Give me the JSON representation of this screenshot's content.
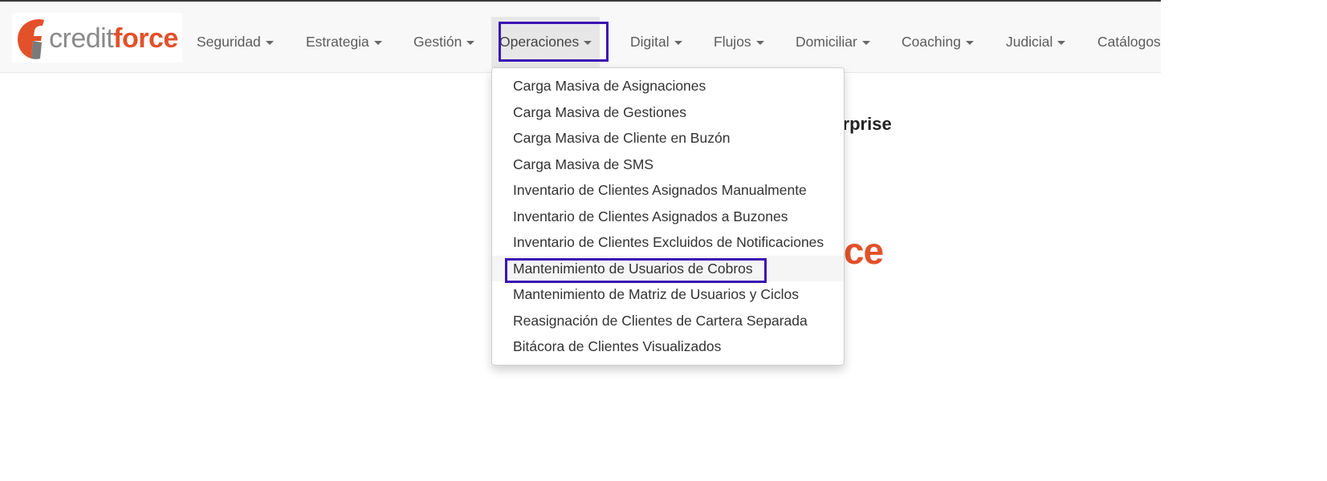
{
  "brand": {
    "credit": "credit",
    "force": "force",
    "logo_icon": "creditforce-f-icon",
    "accent_color": "#e2512a",
    "text_color": "#8a8a8a"
  },
  "nav": {
    "items": [
      {
        "label": "Seguridad"
      },
      {
        "label": "Estrategia"
      },
      {
        "label": "Gestión"
      },
      {
        "label": "Operaciones",
        "active": true
      },
      {
        "label": "Digital"
      },
      {
        "label": "Flujos"
      },
      {
        "label": "Domiciliar"
      },
      {
        "label": "Coaching"
      },
      {
        "label": "Judicial"
      },
      {
        "label": "Catálogos"
      }
    ]
  },
  "hero": {
    "title_fragment": "terprise",
    "logo_fragment": "rce"
  },
  "dropdown": {
    "items": [
      {
        "label": "Carga Masiva de Asignaciones"
      },
      {
        "label": "Carga Masiva de Gestiones"
      },
      {
        "label": "Carga Masiva de Cliente en Buzón"
      },
      {
        "label": "Carga Masiva de SMS"
      },
      {
        "label": "Inventario de Clientes Asignados Manualmente"
      },
      {
        "label": "Inventario de Clientes Asignados a Buzones"
      },
      {
        "label": "Inventario de Clientes Excluidos de Notificaciones"
      },
      {
        "label": "Mantenimiento de Usuarios de Cobros",
        "hovered": true
      },
      {
        "label": "Mantenimiento de Matriz de Usuarios y Ciclos"
      },
      {
        "label": "Reasignación de Clientes de Cartera Separada"
      },
      {
        "label": "Bitácora de Clientes Visualizados"
      }
    ]
  },
  "annotation_color": "#3b12b3"
}
